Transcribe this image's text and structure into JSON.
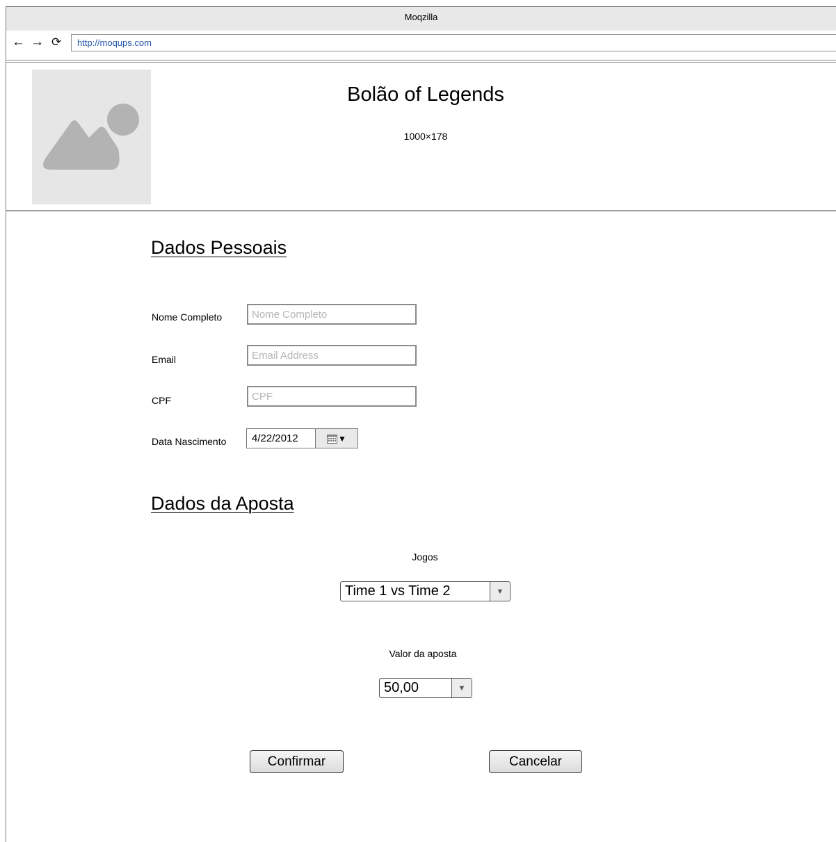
{
  "browser": {
    "window_title": "Moqzilla",
    "url": "http://moqups.com",
    "back_icon": "arrow-left-icon",
    "forward_icon": "arrow-right-icon",
    "reload_icon": "reload-icon"
  },
  "header": {
    "title": "Bolão of Legends",
    "image_size_label": "1000×178",
    "image_icon": "image-placeholder-icon"
  },
  "personal": {
    "heading": "Dados Pessoais",
    "fields": [
      {
        "label": "Nome Completo",
        "placeholder": "Nome Completo",
        "value": ""
      },
      {
        "label": "Email",
        "placeholder": "Email Address",
        "value": ""
      },
      {
        "label": "CPF",
        "placeholder": "CPF",
        "value": ""
      }
    ],
    "birth": {
      "label": "Data Nascimento",
      "value": "4/22/2012",
      "icon": "calendar-icon"
    }
  },
  "bet": {
    "heading": "Dados da Aposta",
    "games_label": "Jogos",
    "games_selected": "Time 1 vs Time 2",
    "amount_label": "Valor da aposta",
    "amount_selected": "50,00",
    "dropdown_icon": "chevron-down-icon"
  },
  "actions": {
    "confirm_label": "Confirmar",
    "cancel_label": "Cancelar"
  },
  "colors": {
    "chrome_bg": "#e8e8e8",
    "url_text": "#2255aa",
    "placeholder_bg": "#e6e6e6",
    "placeholder_icon": "#b3b3b3"
  }
}
